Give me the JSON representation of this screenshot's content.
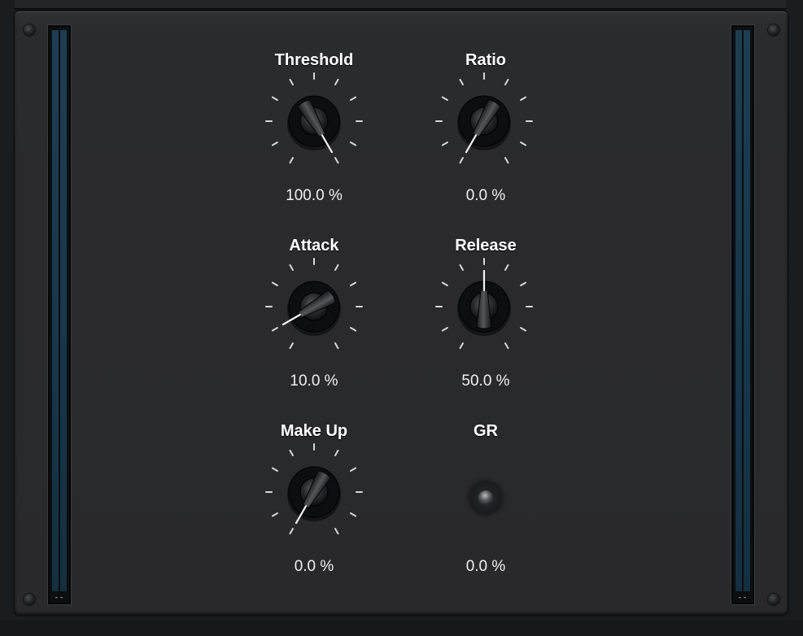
{
  "controls": {
    "threshold": {
      "label": "Threshold",
      "value": "100.0 %",
      "angle": 150
    },
    "ratio": {
      "label": "Ratio",
      "value": "0.0 %",
      "angle": -150
    },
    "attack": {
      "label": "Attack",
      "value": "10.0 %",
      "angle": -120
    },
    "release": {
      "label": "Release",
      "value": "50.0 %",
      "angle": 0
    },
    "makeup": {
      "label": "Make Up",
      "value": "0.0 %",
      "angle": -150
    }
  },
  "gr": {
    "label": "GR",
    "value": "0.0 %"
  },
  "meters": {
    "left_readout": "--",
    "right_readout": "--"
  }
}
